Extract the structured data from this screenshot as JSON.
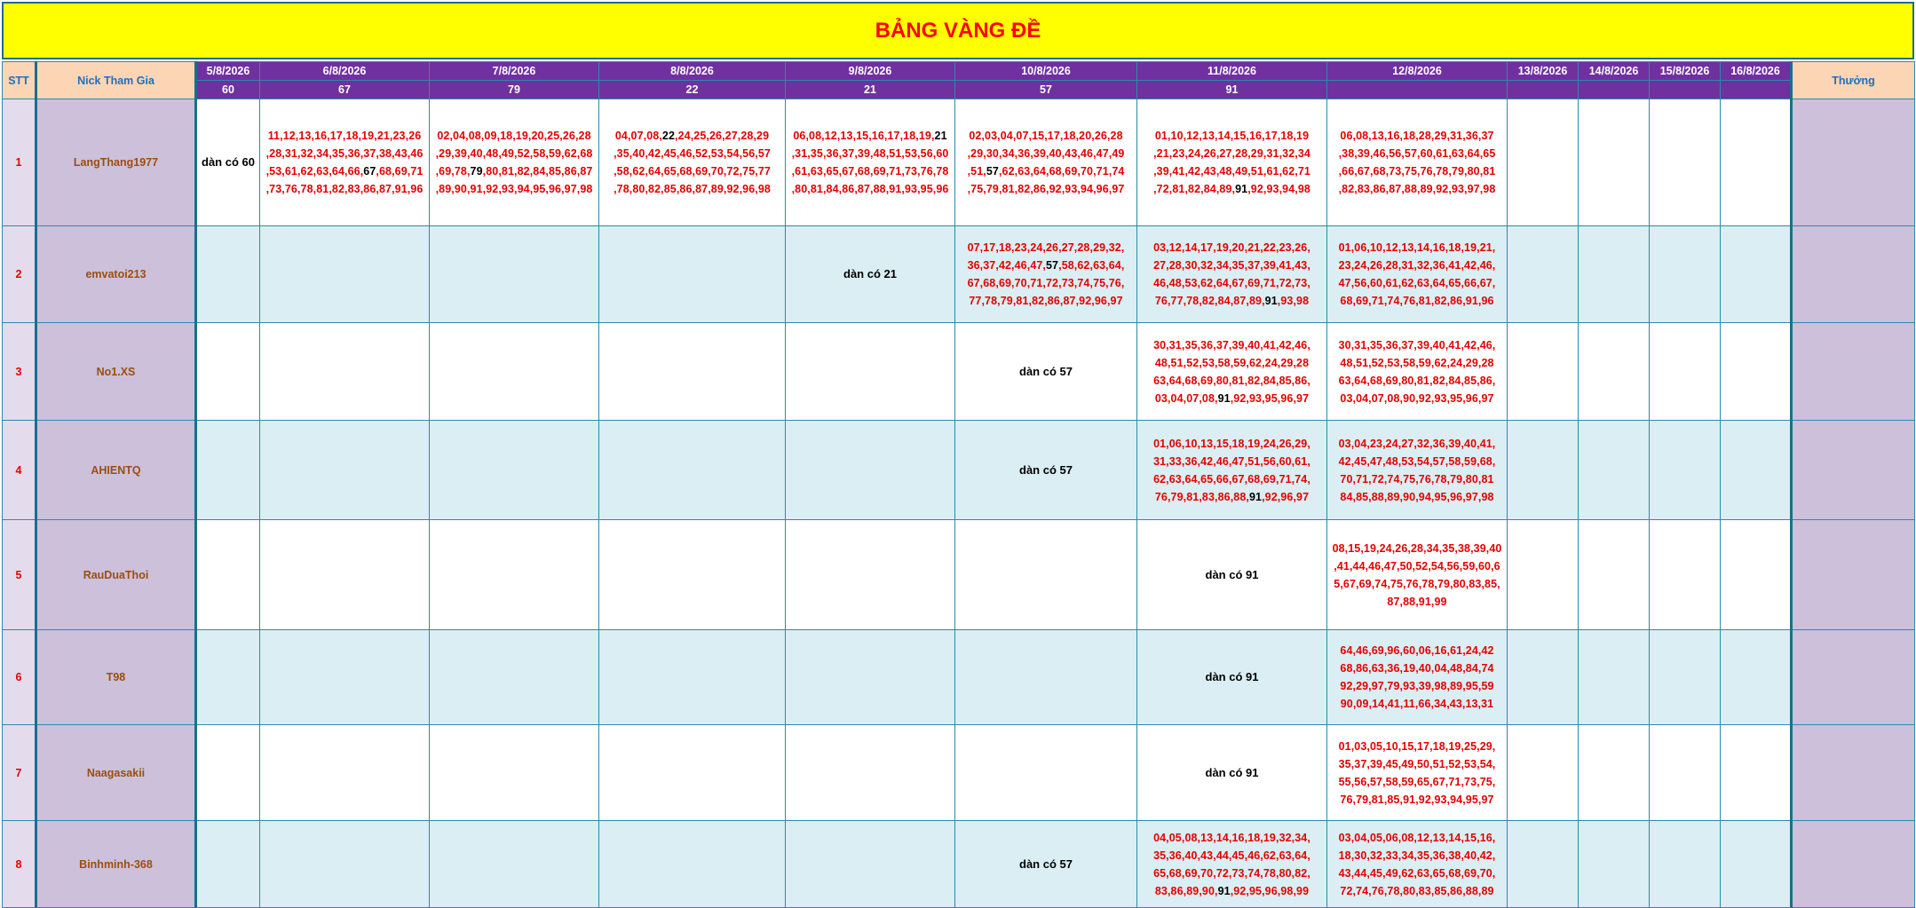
{
  "title": "BẢNG VÀNG ĐỀ",
  "headers": {
    "stt": "STT",
    "nick": "Nick Tham Gia",
    "reward": "Thưởng"
  },
  "dates": [
    "5/8/2026",
    "6/8/2026",
    "7/8/2026",
    "8/8/2026",
    "9/8/2026",
    "10/8/2026",
    "11/8/2026",
    "12/8/2026",
    "13/8/2026",
    "14/8/2026",
    "15/8/2026",
    "16/8/2026"
  ],
  "results": [
    "60",
    "67",
    "79",
    "22",
    "21",
    "57",
    "91",
    "",
    "",
    "",
    "",
    ""
  ],
  "rows": [
    {
      "stt": "1",
      "nick": "LangThang1977",
      "reward": "",
      "cells": [
        {
          "note": "dàn có 60"
        },
        {
          "lines": [
            "11,12,13,16,17,18,19,21,23,26",
            ",28,31,32,34,35,36,37,38,43,46",
            ",53,61,62,63,64,66,67,68,69,71",
            ",73,76,78,81,82,83,86,87,91,96"
          ],
          "hit": "67"
        },
        {
          "lines": [
            "02,04,08,09,18,19,20,25,26,28",
            ",29,39,40,48,49,52,58,59,62,68",
            ",69,78,79,80,81,82,84,85,86,87",
            ",89,90,91,92,93,94,95,96,97,98"
          ],
          "hit": "79"
        },
        {
          "lines": [
            "04,07,08,22,24,25,26,27,28,29",
            ",35,40,42,45,46,52,53,54,56,57",
            ",58,62,64,65,68,69,70,72,75,77",
            ",78,80,82,85,86,87,89,92,96,98"
          ],
          "hit": "22"
        },
        {
          "lines": [
            "06,08,12,13,15,16,17,18,19,21",
            ",31,35,36,37,39,48,51,53,56,60",
            ",61,63,65,67,68,69,71,73,76,78",
            ",80,81,84,86,87,88,91,93,95,96"
          ],
          "hit": "21"
        },
        {
          "lines": [
            "02,03,04,07,15,17,18,20,26,28",
            ",29,30,34,36,39,40,43,46,47,49",
            ",51,57,62,63,64,68,69,70,71,74",
            ",75,79,81,82,86,92,93,94,96,97"
          ],
          "hit": "57"
        },
        {
          "lines": [
            "01,10,12,13,14,15,16,17,18,19",
            ",21,23,24,26,27,28,29,31,32,34",
            ",39,41,42,43,48,49,51,61,62,71",
            ",72,81,82,84,89,91,92,93,94,98"
          ],
          "hit": "91"
        },
        {
          "lines": [
            "06,08,13,16,18,28,29,31,36,37",
            ",38,39,46,56,57,60,61,63,64,65",
            ",66,67,68,73,75,76,78,79,80,81",
            ",82,83,86,87,88,89,92,93,97,98"
          ],
          "hit": ""
        },
        {},
        {},
        {},
        {}
      ]
    },
    {
      "stt": "2",
      "nick": "emvatoi213",
      "reward": "",
      "cells": [
        {},
        {},
        {},
        {},
        {
          "note": "dàn có 21"
        },
        {
          "lines": [
            "07,17,18,23,24,26,27,28,29,32,",
            "36,37,42,46,47,57,58,62,63,64,",
            "67,68,69,70,71,72,73,74,75,76,",
            "77,78,79,81,82,86,87,92,96,97"
          ],
          "hit": "57"
        },
        {
          "lines": [
            "03,12,14,17,19,20,21,22,23,26,",
            "27,28,30,32,34,35,37,39,41,43,",
            "46,48,53,62,64,67,69,71,72,73,",
            "76,77,78,82,84,87,89,91,93,98"
          ],
          "hit": "91"
        },
        {
          "lines": [
            "01,06,10,12,13,14,16,18,19,21,",
            "23,24,26,28,31,32,36,41,42,46,",
            "47,56,60,61,62,63,64,65,66,67,",
            "68,69,71,74,76,81,82,86,91,96"
          ],
          "hit": ""
        },
        {},
        {},
        {},
        {}
      ]
    },
    {
      "stt": "3",
      "nick": "No1.XS",
      "reward": "",
      "cells": [
        {},
        {},
        {},
        {},
        {},
        {
          "note": "dàn có 57"
        },
        {
          "lines": [
            "30,31,35,36,37,39,40,41,42,46,",
            "48,51,52,53,58,59,62,24,29,28",
            "63,64,68,69,80,81,82,84,85,86,",
            "03,04,07,08,91,92,93,95,96,97"
          ],
          "hit": "91"
        },
        {
          "lines": [
            "30,31,35,36,37,39,40,41,42,46,",
            "48,51,52,53,58,59,62,24,29,28",
            "63,64,68,69,80,81,82,84,85,86,",
            "03,04,07,08,90,92,93,95,96,97"
          ],
          "hit": ""
        },
        {},
        {},
        {},
        {}
      ]
    },
    {
      "stt": "4",
      "nick": "AHIENTQ",
      "reward": "",
      "cells": [
        {},
        {},
        {},
        {},
        {},
        {
          "note": "dàn có 57"
        },
        {
          "lines": [
            "01,06,10,13,15,18,19,24,26,29,",
            "31,33,36,42,46,47,51,56,60,61,",
            "62,63,64,65,66,67,68,69,71,74,",
            "76,79,81,83,86,88,91,92,96,97"
          ],
          "hit": "91"
        },
        {
          "lines": [
            "03,04,23,24,27,32,36,39,40,41,",
            "42,45,47,48,53,54,57,58,59,68,",
            "70,71,72,74,75,76,78,79,80,81",
            "84,85,88,89,90,94,95,96,97,98"
          ],
          "hit": ""
        },
        {},
        {},
        {},
        {}
      ]
    },
    {
      "stt": "5",
      "nick": "RauDuaThoi",
      "reward": "",
      "cells": [
        {},
        {},
        {},
        {},
        {},
        {},
        {
          "note": "dàn có 91"
        },
        {
          "lines": [
            "08,15,19,24,26,28,34,35,38,39,40",
            ",41,44,46,47,50,52,54,56,59,60,6",
            "5,67,69,74,75,76,78,79,80,83,85,",
            "87,88,91,99"
          ],
          "hit": ""
        },
        {},
        {},
        {},
        {}
      ]
    },
    {
      "stt": "6",
      "nick": "T98",
      "reward": "",
      "cells": [
        {},
        {},
        {},
        {},
        {},
        {},
        {
          "note": "dàn có 91"
        },
        {
          "lines": [
            "64,46,69,96,60,06,16,61,24,42",
            "68,86,63,36,19,40,04,48,84,74",
            "92,29,97,79,93,39,98,89,95,59",
            "90,09,14,41,11,66,34,43,13,31"
          ],
          "hit": ""
        },
        {},
        {},
        {},
        {}
      ]
    },
    {
      "stt": "7",
      "nick": "Naagasakii",
      "reward": "",
      "cells": [
        {},
        {},
        {},
        {},
        {},
        {},
        {
          "note": "dàn có 91"
        },
        {
          "lines": [
            "01,03,05,10,15,17,18,19,25,29,",
            "35,37,39,45,49,50,51,52,53,54,",
            "55,56,57,58,59,65,67,71,73,75,",
            "76,79,81,85,91,92,93,94,95,97"
          ],
          "hit": ""
        },
        {},
        {},
        {},
        {}
      ]
    },
    {
      "stt": "8",
      "nick": "Binhminh-368",
      "reward": "",
      "cells": [
        {},
        {},
        {},
        {},
        {},
        {
          "note": "dàn có 57"
        },
        {
          "lines": [
            "04,05,08,13,14,16,18,19,32,34,",
            "35,36,40,43,44,45,46,62,63,64,",
            "65,68,69,70,72,73,74,78,80,82,",
            "83,86,89,90,91,92,95,96,98,99"
          ],
          "hit": "91"
        },
        {
          "lines": [
            "03,04,05,06,08,12,13,14,15,16,",
            "18,30,32,33,34,35,36,38,40,42,",
            "43,44,45,49,62,63,65,68,69,70,",
            "72,74,76,78,80,83,85,86,88,89"
          ],
          "hit": ""
        },
        {},
        {},
        {},
        {}
      ]
    }
  ]
}
